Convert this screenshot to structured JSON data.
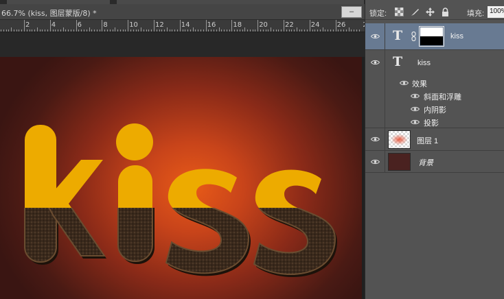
{
  "document": {
    "tab_title": "66.7% (kiss, 图层蒙版/8) *",
    "minimize_label": "–",
    "ruler_marks": [
      "2",
      "4",
      "6",
      "8",
      "10",
      "12",
      "14",
      "16",
      "18",
      "20",
      "22",
      "24",
      "26",
      "2"
    ],
    "canvas_text": "kiss",
    "colors": {
      "text_top": "#edab00",
      "text_bottom": "#3d2a1c",
      "background_center": "#e85a18",
      "background_edge": "#3a1512"
    }
  },
  "layers_panel": {
    "lock_label": "锁定:",
    "lock_icons": [
      "lock-transparent-icon",
      "lock-brush-icon",
      "lock-move-icon",
      "lock-all-icon"
    ],
    "fill_label": "填充:",
    "fill_value": "100%",
    "layers": [
      {
        "name": "kiss",
        "kind": "text",
        "selected": true,
        "has_mask": true
      },
      {
        "name": "kiss",
        "kind": "text",
        "selected": false,
        "has_mask": false,
        "effects_label": "效果",
        "effects": [
          "斜面和浮雕",
          "内阴影",
          "投影"
        ]
      },
      {
        "name": "图层 1",
        "kind": "raster",
        "selected": false
      },
      {
        "name": "背景",
        "kind": "background",
        "selected": false
      }
    ]
  }
}
